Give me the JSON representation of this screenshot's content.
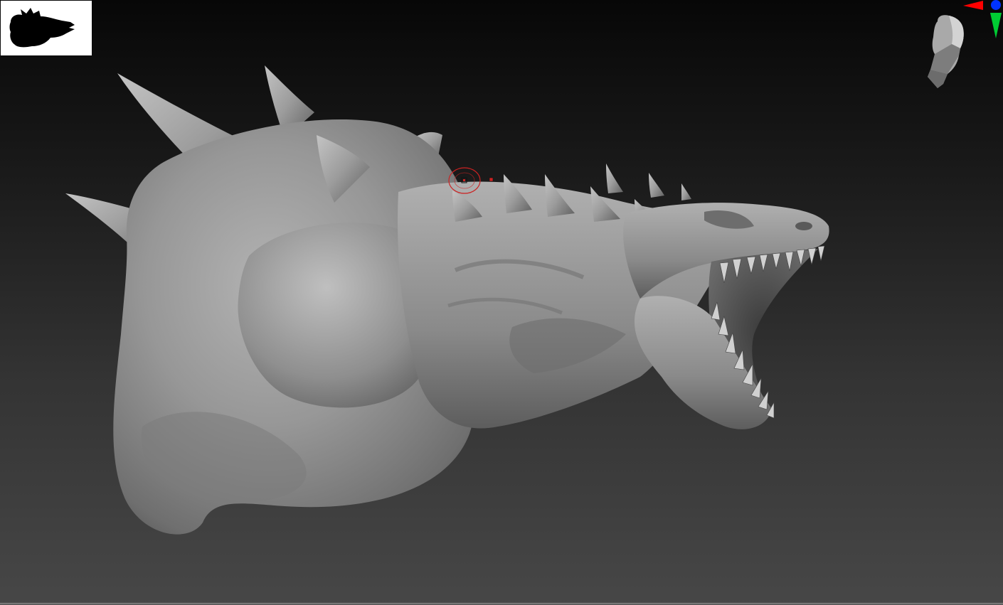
{
  "app": {
    "type": "3d-sculpting-viewport"
  },
  "viewport": {
    "background_top": "#070707",
    "background_bottom": "#474747",
    "model": {
      "material_color": "#8e8e8e",
      "description_icon": "dragon-bust-model"
    }
  },
  "silhouette_nav": {
    "icon": "model-silhouette-thumbnail",
    "background": "#ffffff",
    "fill": "#000000"
  },
  "orientation_widget": {
    "icon": "head-orientation-gizmo",
    "axis_colors": {
      "x": "#ff0000",
      "y": "#00cc33",
      "z": "#0033ff"
    }
  },
  "brush_cursor": {
    "icon": "brush-cursor",
    "color": "#cc2222"
  }
}
